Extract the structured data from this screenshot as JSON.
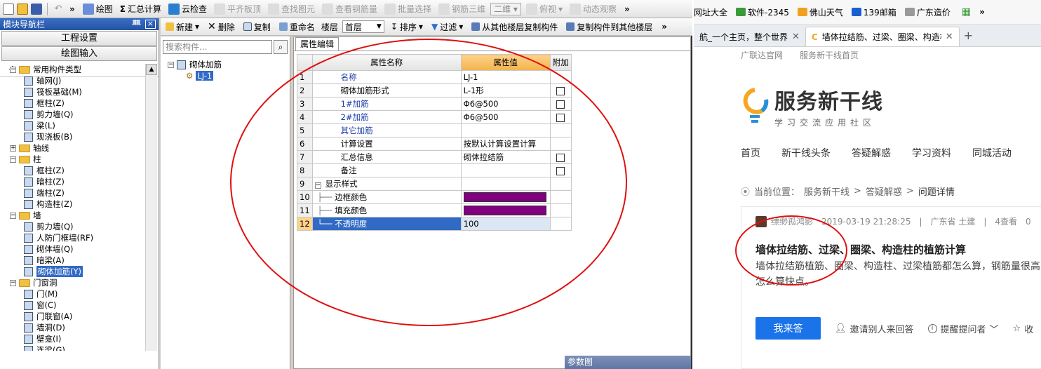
{
  "toolbar": {
    "draw_label": "绘图",
    "sum_label": "汇总计算",
    "cloud_check_label": "云检查",
    "flat_slab_label": "平齐板顶",
    "find_elem_label": "查找图元",
    "view_rebar_label": "查看钢筋量",
    "batch_select_label": "批量选择",
    "rebar_3d_label": "钢筋三维",
    "view_mode_value": "二维",
    "top_view_label": "俯视",
    "dynamic_view_label": "动态观察"
  },
  "nav": {
    "title": "模块导航栏",
    "project_settings": "工程设置",
    "drawing_input": "绘图输入",
    "tree": [
      {
        "level": 0,
        "exp": "−",
        "label": "常用构件类型"
      },
      {
        "level": 1,
        "label": "轴网(J)"
      },
      {
        "level": 1,
        "label": "筏板基础(M)"
      },
      {
        "level": 1,
        "label": "框柱(Z)"
      },
      {
        "level": 1,
        "label": "剪力墙(Q)"
      },
      {
        "level": 1,
        "label": "梁(L)"
      },
      {
        "level": 1,
        "label": "现浇板(B)"
      },
      {
        "level": 0,
        "exp": "+",
        "label": "轴线"
      },
      {
        "level": 0,
        "exp": "−",
        "label": "柱"
      },
      {
        "level": 1,
        "label": "框柱(Z)"
      },
      {
        "level": 1,
        "label": "暗柱(Z)"
      },
      {
        "level": 1,
        "label": "端柱(Z)"
      },
      {
        "level": 1,
        "label": "构造柱(Z)"
      },
      {
        "level": 0,
        "exp": "−",
        "label": "墙"
      },
      {
        "level": 1,
        "label": "剪力墙(Q)"
      },
      {
        "level": 1,
        "label": "人防门框墙(RF)"
      },
      {
        "level": 1,
        "label": "砌体墙(Q)"
      },
      {
        "level": 1,
        "label": "暗梁(A)"
      },
      {
        "level": 1,
        "label": "砌体加筋(Y)",
        "selected": true
      },
      {
        "level": 0,
        "exp": "−",
        "label": "门窗洞"
      },
      {
        "level": 1,
        "label": "门(M)"
      },
      {
        "level": 1,
        "label": "窗(C)"
      },
      {
        "level": 1,
        "label": "门联窗(A)"
      },
      {
        "level": 1,
        "label": "墙洞(D)"
      },
      {
        "level": 1,
        "label": "壁龛(I)"
      },
      {
        "level": 1,
        "label": "连梁(G)"
      }
    ]
  },
  "comp_toolbar": {
    "new_label": "新建",
    "delete_label": "删除",
    "copy_label": "复制",
    "rename_label": "重命名",
    "floor_label": "楼层",
    "floor_value": "首层",
    "sort_label": "排序",
    "filter_label": "过滤",
    "copy_from_label": "从其他楼层复制构件",
    "copy_to_label": "复制构件到其他楼层"
  },
  "comp": {
    "search_placeholder": "搜索构件...",
    "root_label": "砌体加筋",
    "child_label": "LJ-1"
  },
  "prop": {
    "tab_label": "属性编辑",
    "headers": {
      "name": "属性名称",
      "value": "属性值",
      "extra": "附加"
    },
    "rows": [
      {
        "num": "1",
        "name": "名称",
        "value": "LJ-1",
        "blue": true,
        "check": false
      },
      {
        "num": "2",
        "name": "砌体加筋形式",
        "value": "L-1形",
        "blue": false,
        "check": true
      },
      {
        "num": "3",
        "name": "1#加筋",
        "value": "Φ6@500",
        "blue": true,
        "check": true
      },
      {
        "num": "4",
        "name": "2#加筋",
        "value": "Φ6@500",
        "blue": true,
        "check": true
      },
      {
        "num": "5",
        "name": "其它加筋",
        "value": "",
        "blue": true,
        "check": false
      },
      {
        "num": "6",
        "name": "计算设置",
        "value": "按默认计算设置计算",
        "blue": false,
        "check": false
      },
      {
        "num": "7",
        "name": "汇总信息",
        "value": "砌体拉结筋",
        "blue": false,
        "check": true
      },
      {
        "num": "8",
        "name": "备注",
        "value": "",
        "blue": false,
        "check": true
      },
      {
        "num": "9",
        "name": "显示样式",
        "value": "",
        "blue": false,
        "check": false,
        "group": true
      },
      {
        "num": "10",
        "name": "边框颜色",
        "value": "",
        "swatch": "#800080",
        "sub": true
      },
      {
        "num": "11",
        "name": "填充颜色",
        "value": "",
        "swatch": "#800080",
        "sub": true
      },
      {
        "num": "12",
        "name": "不透明度",
        "value": "100",
        "sub": true,
        "selected": true
      }
    ],
    "param_panel_label": "参数图"
  },
  "browser": {
    "bookmarks": [
      "网址大全",
      "软件-2345",
      "佛山天气",
      "139邮箱",
      "广东造价"
    ],
    "tabs": [
      {
        "label": "航_一个主页，整个世界",
        "active": false
      },
      {
        "label": "墙体拉结筋、过梁、圈梁、构造柱",
        "active": true
      }
    ],
    "site_links": [
      "广联达官网",
      "服务新干线首页"
    ],
    "logo_title": "服务新干线",
    "logo_sub": "学习交流应用社区",
    "nav": [
      "首页",
      "新干线头条",
      "答疑解惑",
      "学习资料",
      "同城活动"
    ],
    "crumb_prefix": "当前位置：",
    "crumbs": [
      "服务新干线",
      "答疑解惑",
      "问题详情"
    ],
    "crumb_sep": ">",
    "question": {
      "author": "缥缈孤鸿影",
      "date": "2019-03-19 21:28:25",
      "region": "广东省  土建",
      "views": "4查看",
      "views_extra": "0",
      "title": "墙体拉结筋、过梁、圈梁、构造柱的植筋计算",
      "body": "墙体拉结筋植筋、圈梁、构造柱、过梁植筋都怎么算，钢筋量很高，怎么算快点。",
      "answer_label": "我来答",
      "invite_label": "邀请别人来回答",
      "remind_label": "提醒提问者",
      "collect_label": "收"
    }
  },
  "colors": {
    "swatch": "#800080",
    "annotation": "#e01010",
    "accent": "#1a73e8"
  }
}
